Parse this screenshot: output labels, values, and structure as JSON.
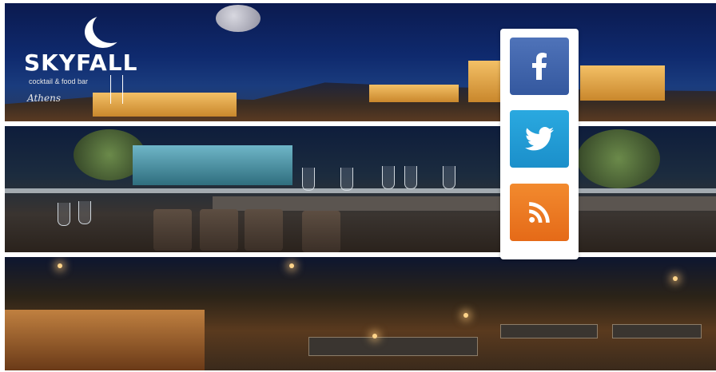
{
  "brand": {
    "name": "SKYFALL",
    "tagline": "cocktail & food bar",
    "city": "Athens"
  },
  "share": {
    "facebook_icon": "facebook-icon",
    "twitter_icon": "twitter-icon",
    "rss_icon": "rss-icon",
    "colors": {
      "facebook": "#3b5998",
      "twitter": "#1da1f2",
      "rss": "#ee802f"
    }
  }
}
